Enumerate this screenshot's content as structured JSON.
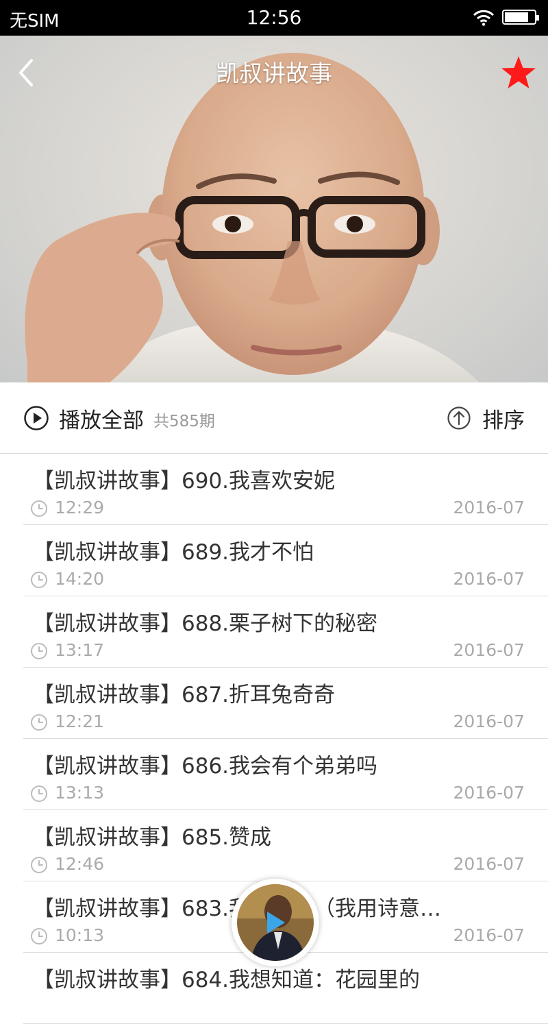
{
  "status_bar": {
    "carrier": "无SIM",
    "time": "12:56",
    "battery_level": 0.8
  },
  "header": {
    "title": "凯叔讲故事",
    "back_icon": "chevron-left-icon",
    "favorite_icon": "star-icon",
    "favorite_color": "#ff1a1a"
  },
  "toolbar": {
    "play_all_label": "播放全部",
    "episode_count": "共585期",
    "sort_label": "排序"
  },
  "episodes": [
    {
      "title": "【凯叔讲故事】690.我喜欢安妮",
      "duration": "12:29",
      "date": "2016-07"
    },
    {
      "title": "【凯叔讲故事】689.我才不怕",
      "duration": "14:20",
      "date": "2016-07"
    },
    {
      "title": "【凯叔讲故事】688.栗子树下的秘密",
      "duration": "13:17",
      "date": "2016-07"
    },
    {
      "title": "【凯叔讲故事】687.折耳兔奇奇",
      "duration": "12:21",
      "date": "2016-07"
    },
    {
      "title": "【凯叔讲故事】686.我会有个弟弟吗",
      "duration": "13:13",
      "date": "2016-07"
    },
    {
      "title": "【凯叔讲故事】685.赞成",
      "duration": "12:46",
      "date": "2016-07"
    },
    {
      "title": "【凯叔讲故事】683.我想知道（我用诗意…",
      "duration": "10:13",
      "date": "2016-07"
    },
    {
      "title": "【凯叔讲故事】684.我想知道：花园里的",
      "duration": "",
      "date": ""
    }
  ],
  "colors": {
    "accent_red": "#ff1a1a",
    "meta_gray": "#aaaaaa",
    "play_blue": "#3aa6e8"
  }
}
